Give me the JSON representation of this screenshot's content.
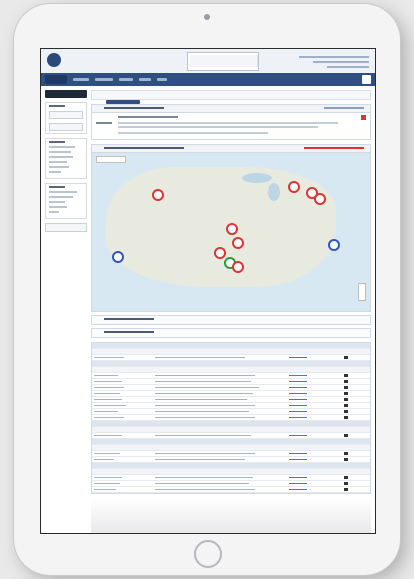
{
  "app": {
    "logo_text": "",
    "logo_sub": ""
  },
  "colors": {
    "nav": "#2e4f7f",
    "accent_red": "#d33",
    "marker_blue": "#3355bb",
    "marker_green": "#2a9a3a"
  },
  "icons": {
    "logo": "turf-logo-icon",
    "search": "search-icon",
    "close": "close-icon",
    "zoom": "map-zoom-icon",
    "chat": "chat-icon"
  },
  "map": {
    "place_label": ""
  }
}
